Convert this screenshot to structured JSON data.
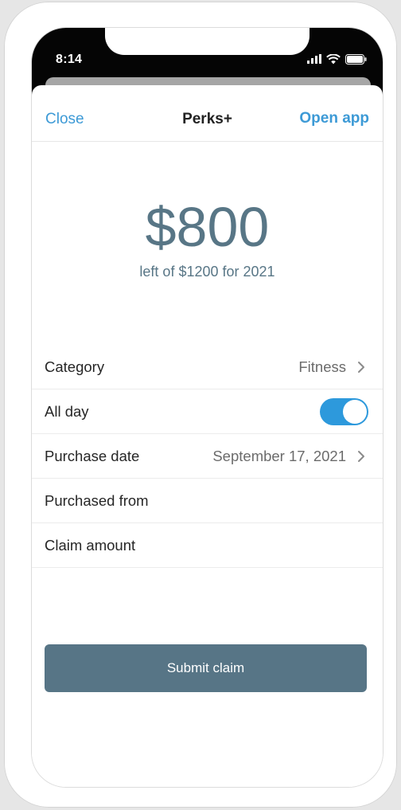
{
  "status": {
    "time": "8:14"
  },
  "nav": {
    "close": "Close",
    "title": "Perks+",
    "open_app": "Open app"
  },
  "summary": {
    "amount": "$800",
    "subtitle": "left of $1200 for 2021"
  },
  "form": {
    "category": {
      "label": "Category",
      "value": "Fitness"
    },
    "all_day": {
      "label": "All day",
      "enabled": true
    },
    "purchase_date": {
      "label": "Purchase date",
      "value": "September 17, 2021"
    },
    "purchased_from": {
      "label": "Purchased from"
    },
    "claim_amount": {
      "label": "Claim amount"
    }
  },
  "submit_label": "Submit claim",
  "colors": {
    "accent": "#3d9ad6",
    "toggle_on": "#2d99dc",
    "primary_button": "#577586",
    "amount_text": "#587686"
  },
  "icons": [
    "signal-icon",
    "wifi-icon",
    "battery-icon",
    "chevron-right-icon"
  ]
}
